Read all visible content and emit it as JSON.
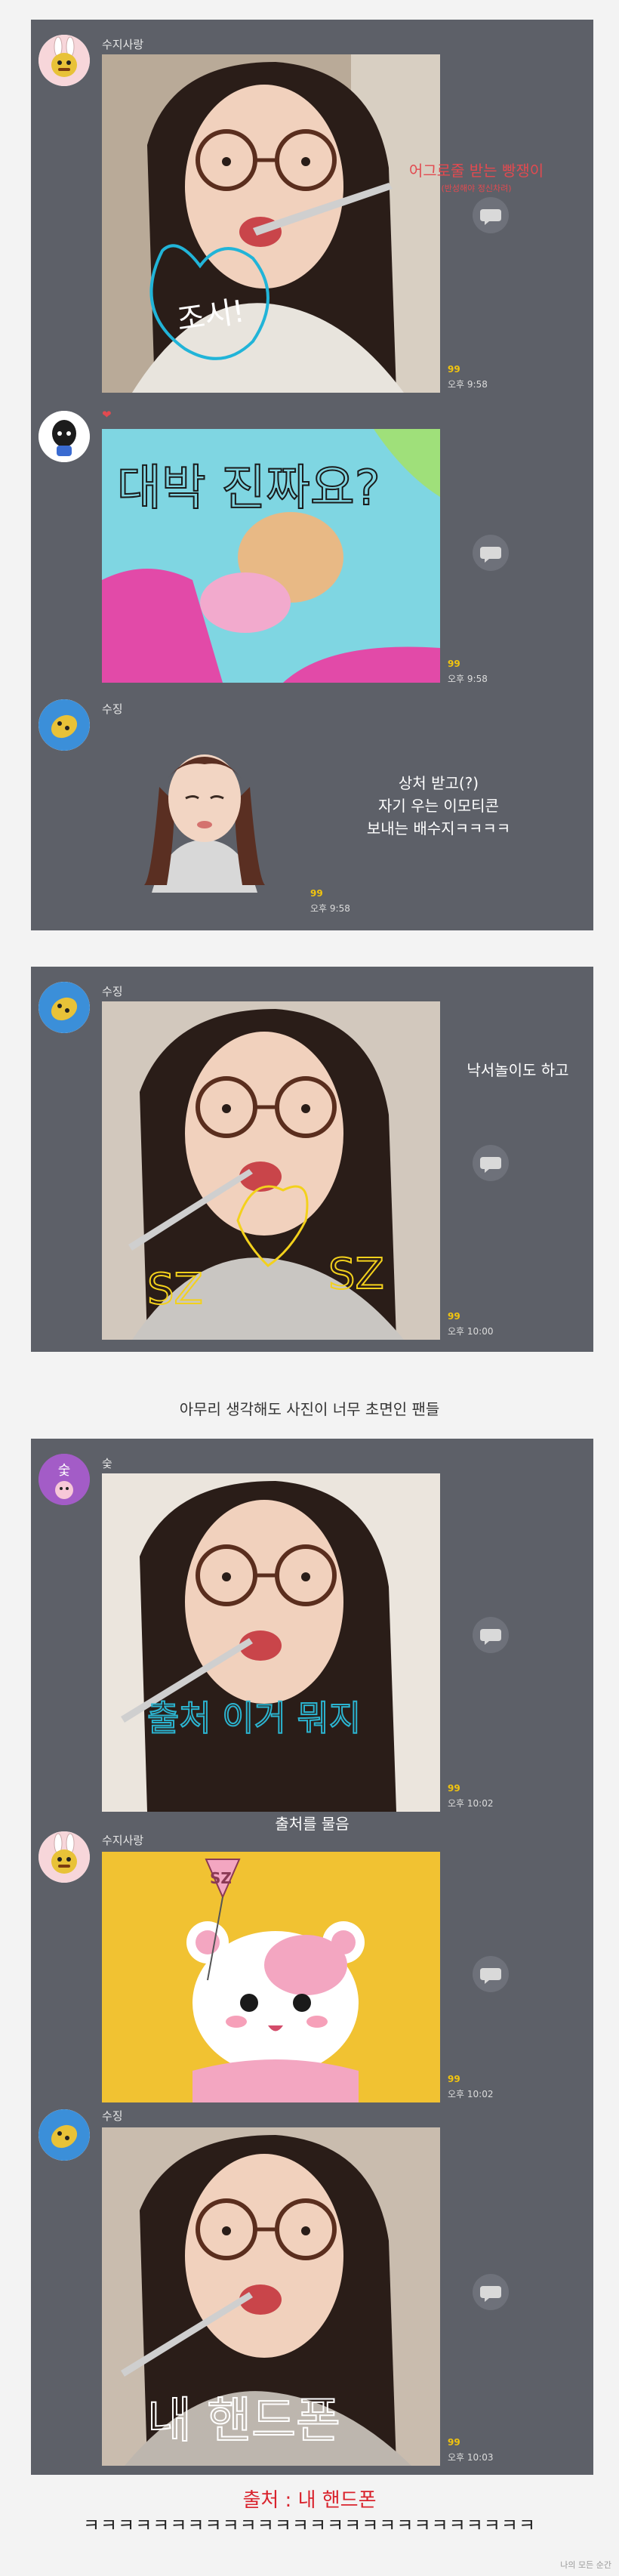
{
  "panel1": {
    "msg1": {
      "sender": "수지사랑",
      "count": "99",
      "time": "오후 9:58",
      "overlay_main": "어그로줄 받는 빵쟁이",
      "overlay_sub": "(반성해야 정신차려)",
      "handwriting": "조시!"
    },
    "msg2": {
      "sender": "❤",
      "count": "99",
      "time": "오후 9:58",
      "handwriting": "대박 진짜요?"
    },
    "msg3": {
      "sender": "수징",
      "count": "99",
      "time": "오후 9:58",
      "text_lines": [
        "상처 받고(?)",
        "자기 우는 이모티콘",
        "보내는 배수지ㅋㅋㅋㅋ"
      ]
    }
  },
  "panel2": {
    "msg1": {
      "sender": "수징",
      "count": "99",
      "time": "오후 10:00",
      "side_text": "낙서놀이도 하고",
      "handwriting": "SZ"
    }
  },
  "caption_middle": "아무리 생각해도 사진이 너무 초면인 팬들",
  "panel3": {
    "msg1": {
      "sender": "숯",
      "avatar_label": "숯",
      "count": "99",
      "time": "오후 10:02",
      "handwriting": "출처 이거 뭐지"
    },
    "caption": "출처를 물음",
    "msg2": {
      "sender": "수지사랑",
      "count": "99",
      "time": "오후 10:02",
      "badge": "SZ"
    },
    "msg3": {
      "sender": "수징",
      "count": "99",
      "time": "오후 10:03",
      "handwriting": "내 핸드폰"
    }
  },
  "footer": {
    "source_line": "출처 : 내 핸드폰",
    "laugh_line": "ㅋㅋㅋㅋㅋㅋㅋㅋㅋㅋㅋㅋㅋㅋㅋㅋㅋㅋㅋㅋㅋㅋㅋㅋㅋㅋ",
    "watermark": "나의 모든 순간"
  },
  "colors": {
    "panel": "#5d6068",
    "count": "#f1c40f",
    "source_red": "#d9232d"
  },
  "icons": [
    "rabbit-avatar-icon",
    "black-character-avatar-icon",
    "blue-mascot-avatar-icon",
    "speech-bubble-icon"
  ]
}
